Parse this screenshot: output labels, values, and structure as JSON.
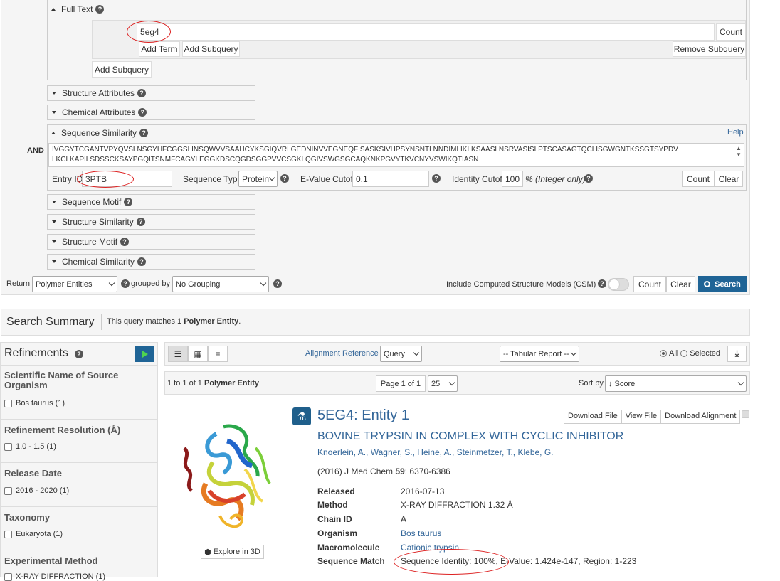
{
  "query_builder": {
    "full_text": {
      "header": "Full Text",
      "term_value": "5eg4",
      "count_label": "Count",
      "add_term": "Add Term",
      "add_subquery_inner": "Add Subquery",
      "remove_subquery": "Remove Subquery",
      "add_subquery_outer": "Add Subquery"
    },
    "collapsed_sections": {
      "structure_attributes": "Structure Attributes",
      "chemical_attributes": "Chemical Attributes",
      "sequence_motif": "Sequence Motif",
      "structure_similarity": "Structure Similarity",
      "structure_motif": "Structure Motif",
      "chemical_similarity": "Chemical Similarity"
    },
    "sequence_similarity": {
      "header": "Sequence Similarity",
      "operator": "AND",
      "help": "Help",
      "sequence_line1": "IVGGYTCGANTVPYQVSLNSGYHFCGGSLINSQWVVSAAHCYKSGIQVRLGEDNINVVEGNEQFISASKSIVHPSYNSNTLNNDIMLIKLKSAASLNSRVASISLPTSCASAGTQCLISGWGNTKSSGTSYPDV",
      "sequence_line2": "LKCLKAPILSDSSCKSAYPGQITSNMFCAGYLEGGKDSCQGDSGGPVVCSGKLQGIVSWGSGCAQKNKPGVYTKVCNYVSWIKQTIASN",
      "entry_id_label": "Entry ID",
      "entry_id_value": "3PTB",
      "sequence_type_label": "Sequence Type",
      "sequence_type_value": "Protein",
      "evalue_label": "E-Value Cutoff",
      "evalue_value": "0.1",
      "identity_label": "Identity Cutoff",
      "identity_value": "100",
      "identity_unit": "% (Integer only)",
      "count_label": "Count",
      "clear_label": "Clear"
    },
    "return_row": {
      "return_label": "Return",
      "return_value": "Polymer Entities",
      "grouped_by_label": "grouped by",
      "grouped_by_value": "No Grouping",
      "csm_label": "Include Computed Structure Models (CSM)",
      "csm_enabled": false,
      "count_label": "Count",
      "clear_label": "Clear",
      "search_label": "Search"
    }
  },
  "summary": {
    "title": "Search Summary",
    "text_prefix": "This query matches 1 ",
    "text_bold": "Polymer Entity",
    "text_suffix": "."
  },
  "refinements": {
    "title": "Refinements",
    "groups": [
      {
        "title": "Scientific Name of Source Organism",
        "items": [
          "Bos taurus (1)"
        ]
      },
      {
        "title": "Refinement Resolution (Å)",
        "items": [
          "1.0 - 1.5 (1)"
        ]
      },
      {
        "title": "Release Date",
        "items": [
          "2016 - 2020 (1)"
        ]
      },
      {
        "title": "Taxonomy",
        "items": [
          "Eukaryota (1)"
        ]
      },
      {
        "title": "Experimental Method",
        "items": [
          "X-RAY DIFFRACTION (1)"
        ]
      }
    ]
  },
  "results_toolbar": {
    "alignment_reference_label": "Alignment Reference",
    "alignment_reference_value": "Query",
    "report_value": "-- Tabular Report --",
    "view_all": "All",
    "view_selected": "Selected",
    "count_prefix": "1 to 1 of 1 ",
    "count_bold": "Polymer Entity",
    "page_label": "Page 1 of 1",
    "page_size": "25",
    "sort_label": "Sort by",
    "sort_value": "↓ Score"
  },
  "result": {
    "title": "5EG4: Entity 1",
    "subtitle": "BOVINE TRYPSIN IN COMPLEX WITH CYCLIC INHIBITOR",
    "authors": "Knoerlein, A., Wagner, S., Heine, A., Steinmetzer, T., Klebe, G.",
    "citation_prefix": "(2016) J Med Chem ",
    "citation_volume": "59",
    "citation_pages": ": 6370-6386",
    "download_file": "Download File",
    "view_file": "View File",
    "download_alignment": "Download Alignment",
    "explore_3d": "Explore in 3D",
    "details": {
      "released_label": "Released",
      "released_value": "2016-07-13",
      "method_label": "Method",
      "method_value": "X-RAY DIFFRACTION 1.32 Å",
      "chain_label": "Chain ID",
      "chain_value": "A",
      "organism_label": "Organism",
      "organism_value": "Bos taurus",
      "macromolecule_label": "Macromolecule",
      "macromolecule_value": "Cationic trypsin",
      "seqmatch_label": "Sequence Match",
      "seqmatch_value": "Sequence Identity: 100%, E-Value: 1.424e-147, Region: 1-223"
    }
  },
  "colors": {
    "link": "#336699",
    "search_btn": "#1f6496",
    "annotation": "#dd2222"
  }
}
